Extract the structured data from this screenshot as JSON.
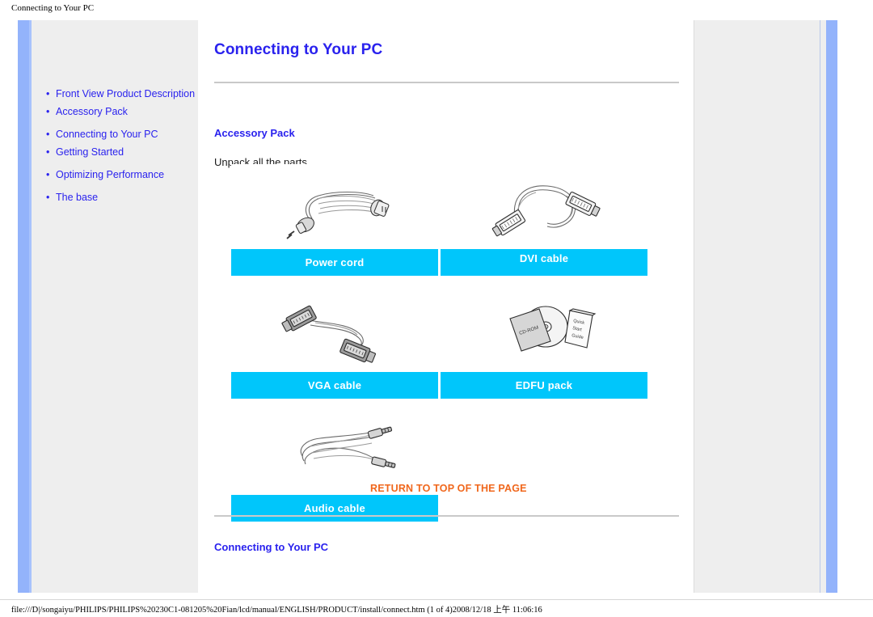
{
  "browser": {
    "title": "Connecting to Your PC",
    "status_path": "file:///D|/songaiyu/PHILIPS/PHILIPS%20230C1-081205%20Fian/lcd/manual/ENGLISH/PRODUCT/install/connect.htm (1 of 4)2008/12/18 上午 11:06:16"
  },
  "sidebar": {
    "items": [
      {
        "label": "Front View Product Description"
      },
      {
        "label": "Accessory Pack"
      },
      {
        "label": "Connecting to Your PC"
      },
      {
        "label": "Getting Started"
      },
      {
        "label": "Optimizing Performance"
      },
      {
        "label": "The base"
      }
    ]
  },
  "content": {
    "page_title": "Connecting to Your PC",
    "accessory_heading": "Accessory Pack",
    "intro_text": "Unpack all the parts.",
    "connecting_heading": "Connecting to Your PC",
    "return_to_top": "RETURN TO TOP OF THE PAGE",
    "accessories": [
      {
        "label": "Power cord",
        "icon": "power-cord-illustration"
      },
      {
        "label": "DVI cable",
        "icon": "dvi-cable-illustration"
      },
      {
        "label": "VGA cable",
        "icon": "vga-cable-illustration"
      },
      {
        "label": "EDFU pack",
        "icon": "edfu-pack-illustration"
      },
      {
        "label": "Audio cable",
        "icon": "audio-cable-illustration"
      }
    ]
  },
  "colors": {
    "link_blue": "#2a22ee",
    "caption_cyan": "#00c6fb",
    "return_orange": "#f0671c",
    "sidebar_gray": "#eeeeee",
    "frame_blue": "#93b3fb"
  }
}
